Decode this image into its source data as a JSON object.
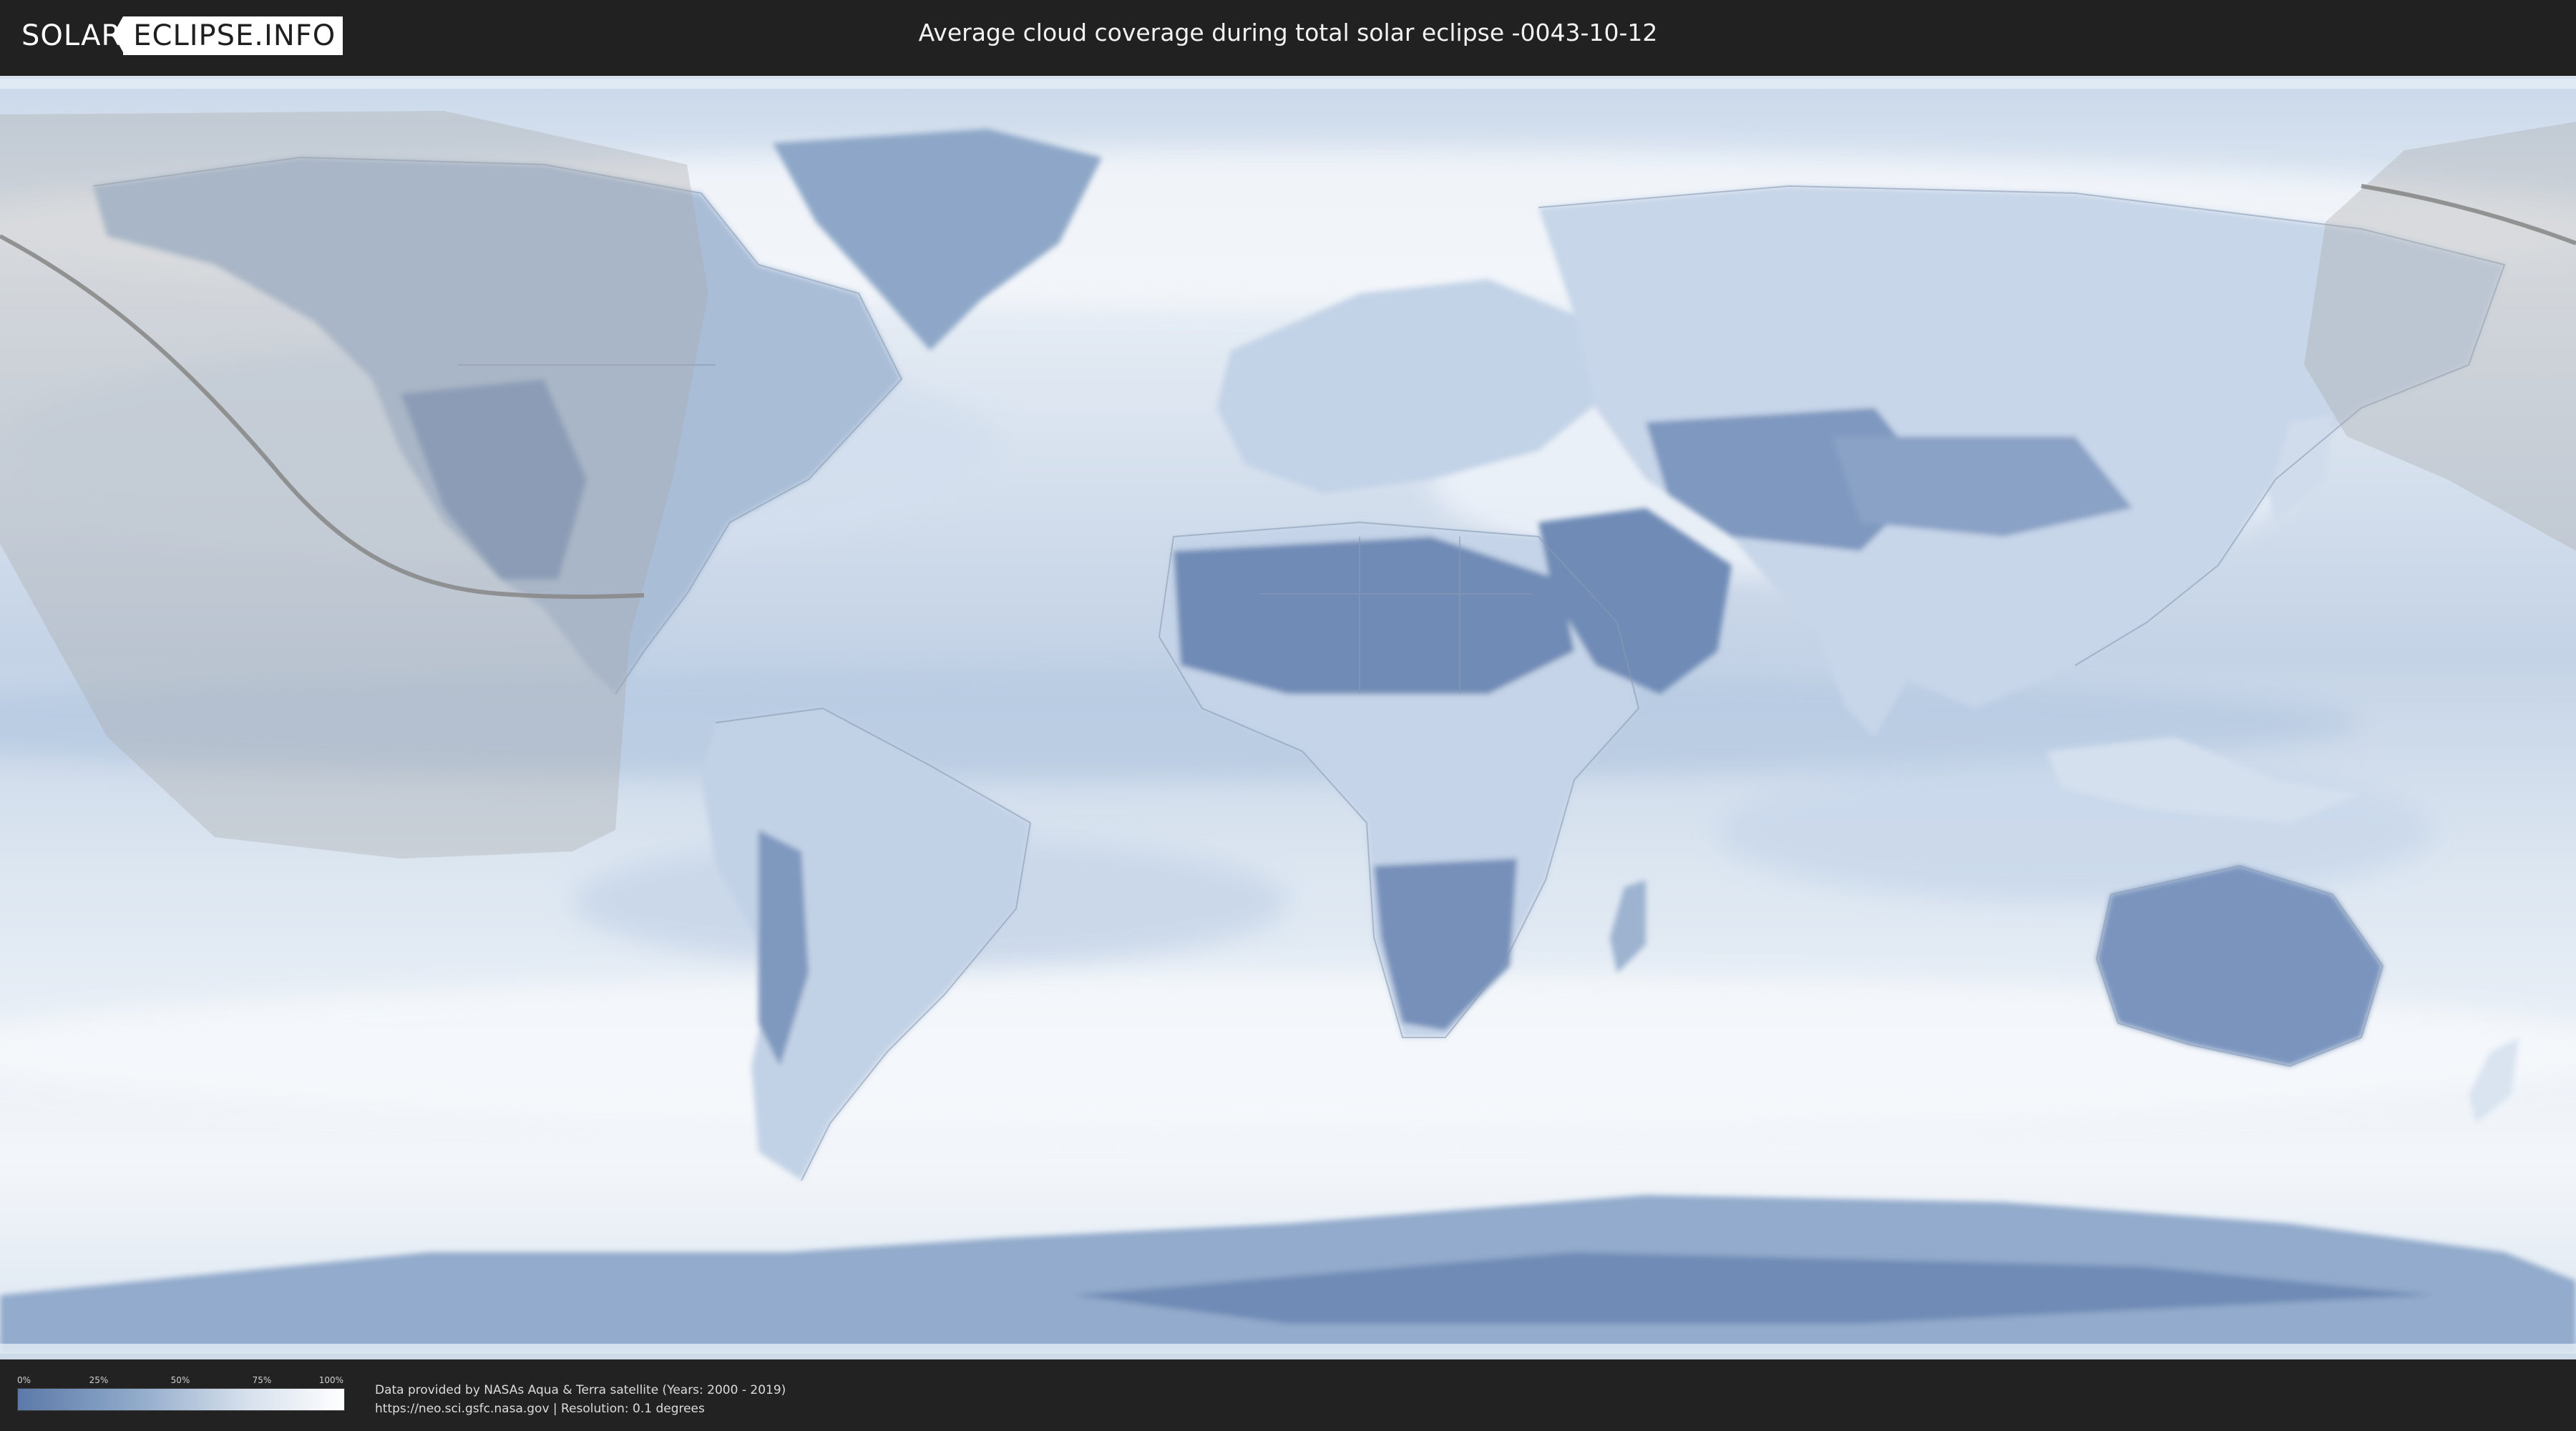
{
  "header": {
    "logo_part1": "SOLAR",
    "logo_part2": "ECLIPSE.INFO",
    "title": "Average cloud coverage during total solar eclipse -0043-10-12"
  },
  "map": {
    "description_layers": [
      "cloud-coverage-raster",
      "country-borders",
      "eclipse-visibility-shading",
      "totality-path-line"
    ],
    "colors": {
      "clear_sky": "#5c7aa8",
      "full_cloud": "#ffffff",
      "visibility_shade": "#9a9a9a",
      "path_line": "#8a8a8a"
    }
  },
  "legend": {
    "ticks": [
      "0%",
      "25%",
      "50%",
      "75%",
      "100%"
    ]
  },
  "footer": {
    "credit_line1": "Data provided by NASAs Aqua & Terra satellite (Years: 2000 - 2019)",
    "credit_line2": "https://neo.sci.gsfc.nasa.gov | Resolution: 0.1 degrees"
  }
}
